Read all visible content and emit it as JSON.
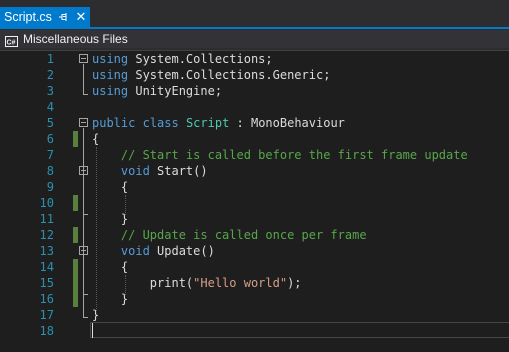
{
  "tab": {
    "title": "Script.cs",
    "pin_icon": "pin-icon",
    "close_icon": "close-icon",
    "close_glyph": "✕"
  },
  "navbar": {
    "icon": "project-icon",
    "label": "Miscellaneous Files"
  },
  "editor": {
    "colors": {
      "keyword": "#569cd6",
      "type": "#4ec9b0",
      "comment": "#57a64a",
      "string": "#d69d85",
      "line_number": "#2b91af",
      "change_bar": "#57803a"
    },
    "line_numbers": [
      "1",
      "2",
      "3",
      "4",
      "5",
      "6",
      "7",
      "8",
      "9",
      "10",
      "11",
      "12",
      "13",
      "14",
      "15",
      "16",
      "17",
      "18"
    ],
    "lines": {
      "l1": {
        "kw": "using",
        "rest": " System.Collections;"
      },
      "l2": {
        "kw": "using",
        "rest": " System.Collections.Generic;"
      },
      "l3": {
        "kw": "using",
        "rest": " UnityEngine;"
      },
      "l5": {
        "kw1": "public",
        "sp1": " ",
        "kw2": "class",
        "sp2": " ",
        "type": "Script",
        "rest": " : MonoBehaviour"
      },
      "l6": {
        "text": "{"
      },
      "l7": {
        "indent": "    ",
        "comment": "// Start is called before the first frame update"
      },
      "l8": {
        "indent": "    ",
        "kw": "void",
        "rest": " Start()"
      },
      "l9": {
        "text": "    {"
      },
      "l11": {
        "text": "    }"
      },
      "l12": {
        "indent": "    ",
        "comment": "// Update is called once per frame"
      },
      "l13": {
        "indent": "    ",
        "kw": "void",
        "rest": " Update()"
      },
      "l14": {
        "text": "    {"
      },
      "l15": {
        "pre": "        print(",
        "str": "\"Hello world\"",
        "post": ");"
      },
      "l16": {
        "text": "    }"
      },
      "l17": {
        "text": "}"
      }
    }
  }
}
